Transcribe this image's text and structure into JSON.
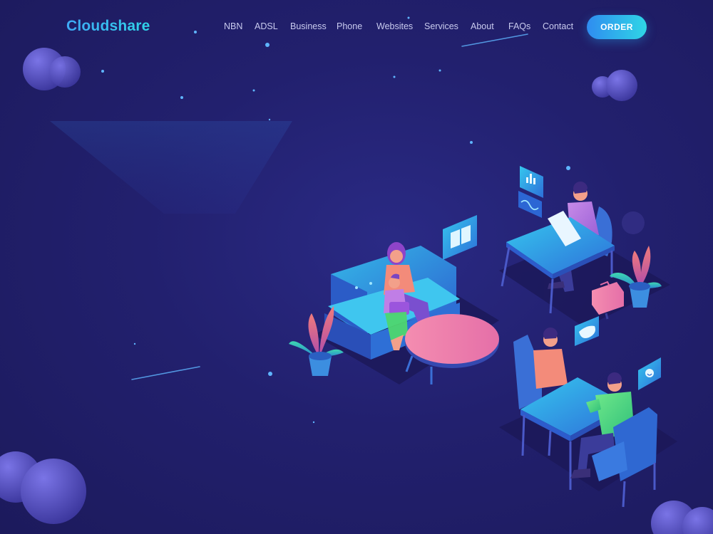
{
  "brand": {
    "name": "Cloudshare"
  },
  "nav": {
    "items": [
      {
        "label": "NBN"
      },
      {
        "label": "ADSL"
      },
      {
        "label": "Business"
      },
      {
        "label": "Phone"
      },
      {
        "label": "Websites"
      },
      {
        "label": "Services"
      },
      {
        "label": "About"
      },
      {
        "label": "FAQs"
      },
      {
        "label": "Contact"
      }
    ],
    "order_label": "ORDER"
  },
  "colors": {
    "background": "#22206e",
    "accent_start": "#2f8cf0",
    "accent_end": "#2fd6e6",
    "sphere": "#5a55c8"
  },
  "illustration": {
    "icons": [
      "book-icon",
      "bar-chart-icon",
      "wave-chart-icon",
      "gamepad-icon",
      "smiley-icon",
      "briefcase-icon"
    ]
  }
}
